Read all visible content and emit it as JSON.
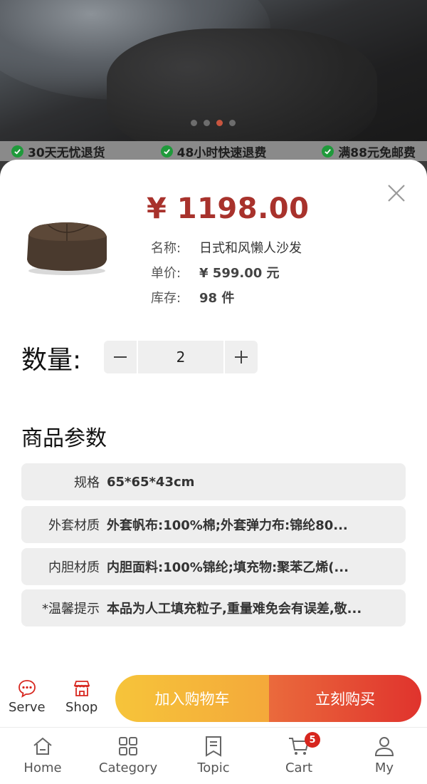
{
  "banner": {
    "dots": [
      false,
      false,
      true,
      false
    ]
  },
  "guarantees": [
    "30天无忧退货",
    "48小时快速退费",
    "满88元免邮费"
  ],
  "product": {
    "price": "¥ 1198.00",
    "name_label": "名称:",
    "name": "日式和风懒人沙发",
    "unit_label": "单价:",
    "unit_price": "¥ 599.00 元",
    "stock_label": "库存:",
    "stock": "98 件"
  },
  "quantity": {
    "label": "数量:",
    "value": "2"
  },
  "params": {
    "title": "商品参数",
    "rows": [
      {
        "key": "规格",
        "value": "65*65*43cm"
      },
      {
        "key": "外套材质",
        "value": "外套帆布:100%棉;外套弹力布:锦纶80..."
      },
      {
        "key": "内胆材质",
        "value": "内胆面料:100%锦纶;填充物:聚苯乙烯(..."
      },
      {
        "key": "*温馨提示",
        "value": "本品为人工填充粒子,重量难免会有误差,敬..."
      }
    ]
  },
  "actions": {
    "serve": "Serve",
    "shop": "Shop",
    "add_to_cart": "加入购物车",
    "buy_now": "立刻购买"
  },
  "tabbar": {
    "items": [
      {
        "label": "Home",
        "icon": "home-icon"
      },
      {
        "label": "Category",
        "icon": "category-icon"
      },
      {
        "label": "Topic",
        "icon": "topic-icon"
      },
      {
        "label": "Cart",
        "icon": "cart-icon",
        "badge": "5"
      },
      {
        "label": "My",
        "icon": "user-icon"
      }
    ]
  },
  "colors": {
    "price": "#a8322c",
    "accent_red": "#e0332d",
    "accent_yellow": "#f6c43a",
    "check_green": "#1f9a3b"
  }
}
